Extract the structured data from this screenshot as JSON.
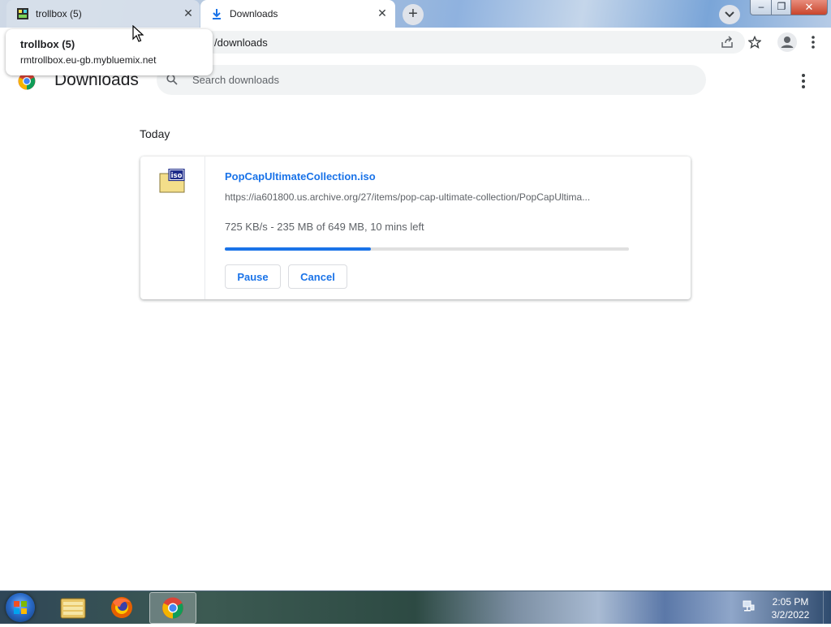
{
  "browser": {
    "tabs": [
      {
        "title": "trollbox (5)",
        "active": false,
        "icon": "trollbox-favicon"
      },
      {
        "title": "Downloads",
        "active": true,
        "icon": "download-icon"
      }
    ],
    "address": "/downloads",
    "tooltip": {
      "title": "trollbox (5)",
      "url": "rmtrollbox.eu-gb.mybluemix.net"
    },
    "window_controls": {
      "minimize": "–",
      "maximize": "❐",
      "close": "✕"
    }
  },
  "page": {
    "title": "Downloads",
    "search_placeholder": "Search downloads"
  },
  "downloads": {
    "section_label": "Today",
    "items": [
      {
        "file_name": "PopCapUltimateCollection.iso",
        "url": "https://ia601800.us.archive.org/27/items/pop-cap-ultimate-collection/PopCapUltima...",
        "status": "725 KB/s - 235 MB of 649 MB, 10 mins left",
        "progress": 0.362,
        "pause_label": "Pause",
        "cancel_label": "Cancel",
        "icon": "iso-file-icon"
      }
    ]
  },
  "taskbar": {
    "time": "2:05 PM",
    "date": "3/2/2022",
    "apps": [
      "file-explorer-icon",
      "firefox-icon",
      "chrome-icon"
    ]
  },
  "colors": {
    "accent": "#1a73e8",
    "progress_track": "#e0e0e0"
  }
}
